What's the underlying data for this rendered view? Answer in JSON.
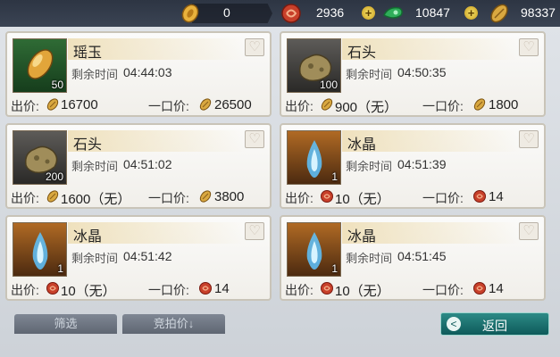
{
  "currencies": [
    {
      "name": "silver-coin",
      "value": "0"
    },
    {
      "name": "red-coin",
      "value": "2936"
    },
    {
      "name": "jade",
      "value": "10847"
    },
    {
      "name": "gold-coin",
      "value": "98337"
    }
  ],
  "labels": {
    "remain": "剩余时间",
    "bid": "出价:",
    "buyout": "一口价:"
  },
  "items": [
    {
      "name": "瑶玉",
      "qty": "50",
      "time": "04:44:03",
      "bid": "16700",
      "buyout": "26500",
      "icon": "gold-coin",
      "thumb": "green"
    },
    {
      "name": "石头",
      "qty": "100",
      "time": "04:50:35",
      "bid": "900（无）",
      "buyout": "1800",
      "icon": "gold-coin",
      "thumb": "dark"
    },
    {
      "name": "石头",
      "qty": "200",
      "time": "04:51:02",
      "bid": "1600（无）",
      "buyout": "3800",
      "icon": "gold-coin",
      "thumb": "dark"
    },
    {
      "name": "冰晶",
      "qty": "1",
      "time": "04:51:39",
      "bid": "10（无）",
      "buyout": "14",
      "icon": "red-coin",
      "thumb": "orange"
    },
    {
      "name": "冰晶",
      "qty": "1",
      "time": "04:51:42",
      "bid": "10（无）",
      "buyout": "14",
      "icon": "red-coin",
      "thumb": "orange"
    },
    {
      "name": "冰晶",
      "qty": "1",
      "time": "04:51:45",
      "bid": "10（无）",
      "buyout": "14",
      "icon": "red-coin",
      "thumb": "orange"
    }
  ],
  "footer": {
    "filter": "筛选",
    "sort": "竞拍价↓",
    "back": "返回"
  }
}
